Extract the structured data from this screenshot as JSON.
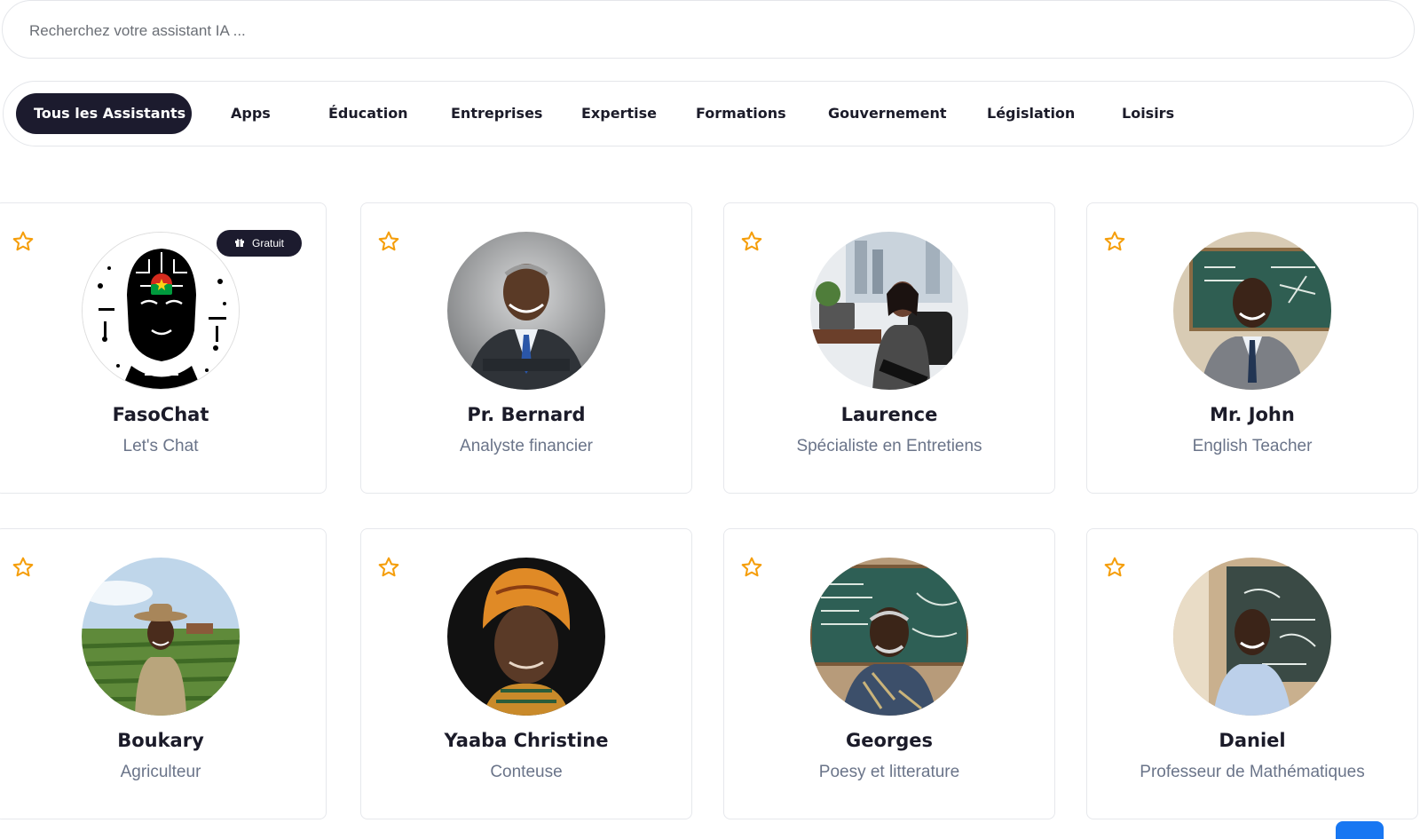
{
  "search": {
    "placeholder": "Recherchez votre assistant IA ..."
  },
  "tabs": [
    {
      "label": "Tous les Assistants",
      "active": true
    },
    {
      "label": "Apps"
    },
    {
      "label": "Éducation"
    },
    {
      "label": "Entreprises"
    },
    {
      "label": "Expertise"
    },
    {
      "label": "Formations"
    },
    {
      "label": "Gouvernement"
    },
    {
      "label": "Législation"
    },
    {
      "label": "Loisirs"
    }
  ],
  "assistants": [
    {
      "name": "FasoChat",
      "role": "Let's Chat",
      "badge": "Gratuit",
      "badge_icon": "gift-icon"
    },
    {
      "name": "Pr. Bernard",
      "role": "Analyste financier"
    },
    {
      "name": "Laurence",
      "role": "Spécialiste en Entretiens"
    },
    {
      "name": "Mr. John",
      "role": "English Teacher"
    },
    {
      "name": "Boukary",
      "role": "Agriculteur"
    },
    {
      "name": "Yaaba Christine",
      "role": "Conteuse"
    },
    {
      "name": "Georges",
      "role": "Poesy et litterature"
    },
    {
      "name": "Daniel",
      "role": "Professeur de Mathématiques"
    }
  ],
  "colors": {
    "accent_dark": "#1c1b2e",
    "star": "#f59e0b",
    "role_text": "#6a7489",
    "scroll_button": "#1877f2"
  }
}
